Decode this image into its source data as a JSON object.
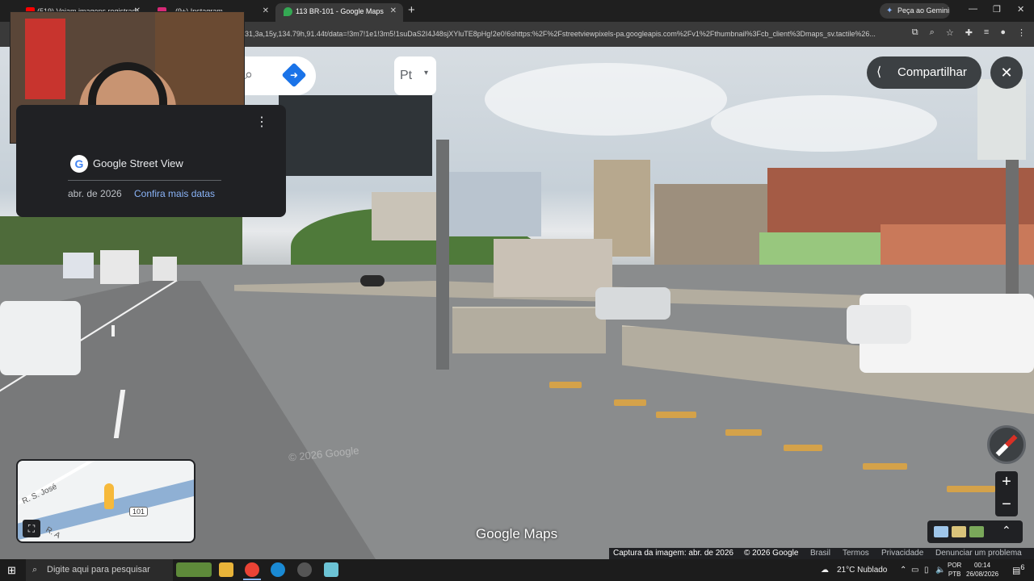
{
  "browser": {
    "tabs": [
      {
        "label": "(519) Vejam imagens registrad...",
        "favicon_color": "#ff0000",
        "active": false
      },
      {
        "label": "(9+) Instagram",
        "favicon_color": "#d62976",
        "active": false
      },
      {
        "label": "113 BR-101 - Google Maps",
        "favicon_color": "#34a853",
        "active": true
      }
    ],
    "new_tab_icon": "plus-icon",
    "gemini_label": "Peça ao Gemini",
    "url": "31,3a,15y,134.79h,91.44t/data=!3m7!1e1!3m5!1suDaS2I4J48sjXYluTE8pHg!2e0!6shttps:%2F%2Fstreetviewpixels-pa.googleapis.com%2Fv1%2Fthumbnail%3Fcb_client%3Dmaps_sv.tactile%26..."
  },
  "streetview": {
    "card_title": "Google Street View",
    "date": "abr. de 2026",
    "more_dates": "Confira mais datas",
    "language_label": "Pt",
    "share_label": "Compartilhar",
    "watermark": "© 2026 Google",
    "brand": "Google Maps",
    "minimap": {
      "street1": "R. S. José",
      "route": "101",
      "street2": "R. A"
    }
  },
  "footer": {
    "capture": "Captura da imagem: abr. de 2026",
    "copyright": "© 2026 Google",
    "country": "Brasil",
    "terms": "Termos",
    "privacy": "Privacidade",
    "report": "Denunciar um problema"
  },
  "taskbar": {
    "search_placeholder": "Digite aqui para pesquisar",
    "weather": "21°C  Nublado",
    "lang_line1": "POR",
    "lang_line2": "PTB",
    "time": "00:14",
    "date": "26/08/2026",
    "notif_count": "6"
  }
}
